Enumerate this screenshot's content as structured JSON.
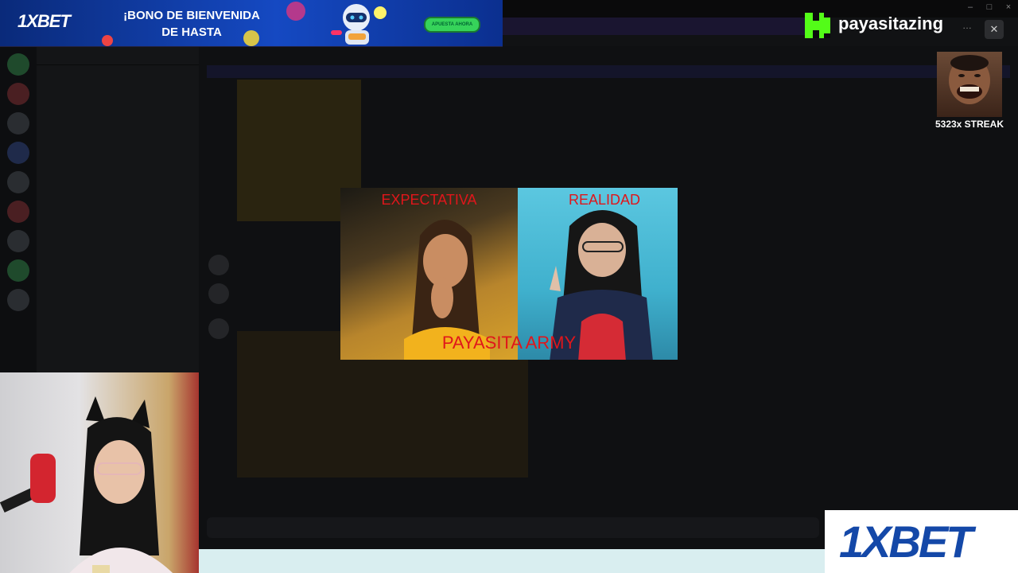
{
  "ad_banner": {
    "brand": "1XBET",
    "headline_line1": "¡BONO DE BIENVENIDA",
    "headline_line2": "DE HASTA",
    "cta": "APUESTA AHORA"
  },
  "channel": {
    "platform_icon": "kick-logo-icon",
    "name": "payasitazing"
  },
  "streak": {
    "label": "5323x STREAK"
  },
  "meme": {
    "left_label": "EXPECTATIVA",
    "right_label": "REALIDAD",
    "caption": "PAYASITA ARMY"
  },
  "sponsor_corner": {
    "brand": "1XBET"
  },
  "colors": {
    "kick_green": "#53fc18",
    "meme_red": "#e0161b",
    "xbet_blue": "#1448a8"
  }
}
